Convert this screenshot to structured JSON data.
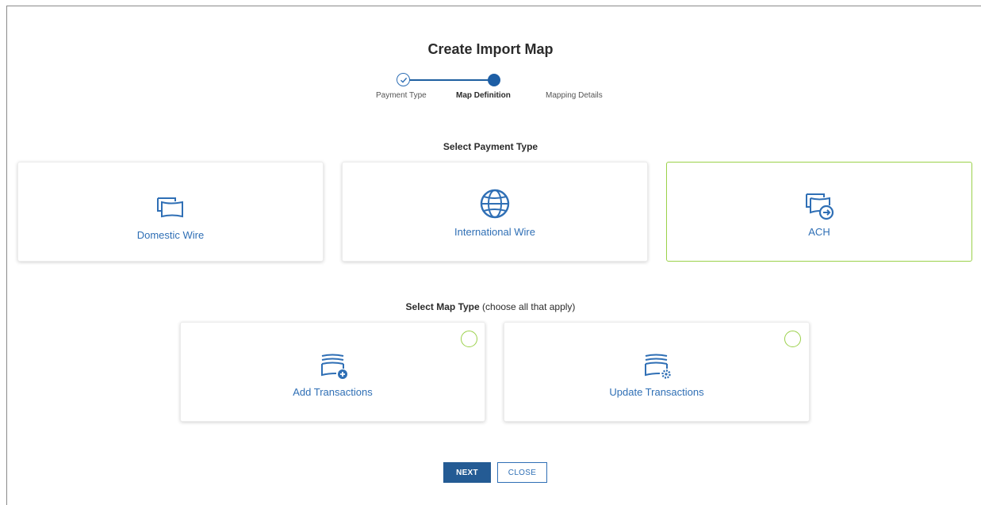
{
  "title": "Create Import Map",
  "stepper": {
    "steps": [
      {
        "label": "Payment Type",
        "state": "complete"
      },
      {
        "label": "Map Definition",
        "state": "active"
      },
      {
        "label": "Mapping Details",
        "state": "pending"
      }
    ]
  },
  "payment_section": {
    "label": "Select Payment Type",
    "options": [
      {
        "label": "Domestic Wire",
        "icon": "bills-icon",
        "selected": false
      },
      {
        "label": "International Wire",
        "icon": "globe-icon",
        "selected": false
      },
      {
        "label": "ACH",
        "icon": "bills-arrow-icon",
        "selected": true
      }
    ]
  },
  "map_section": {
    "label_bold": "Select Map Type",
    "label_hint": "(choose all that apply)",
    "options": [
      {
        "label": "Add Transactions",
        "icon": "document-add-icon",
        "checked": false
      },
      {
        "label": "Update Transactions",
        "icon": "document-gear-icon",
        "checked": false
      }
    ]
  },
  "buttons": {
    "next": "NEXT",
    "close": "CLOSE"
  },
  "colors": {
    "accent_blue": "#2f6fb5",
    "primary_button": "#245b94",
    "selected_green": "#9bd14a"
  }
}
